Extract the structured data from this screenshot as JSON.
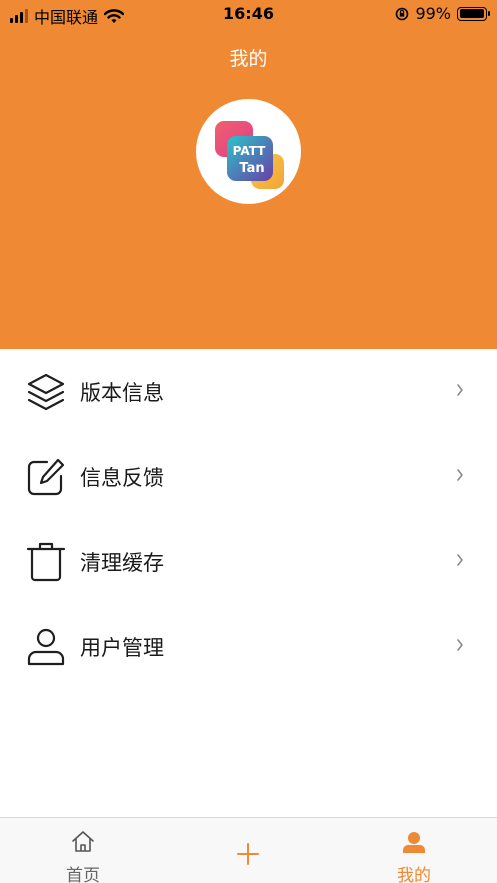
{
  "status_bar": {
    "carrier": "中国联通",
    "time": "16:46",
    "battery": "99%",
    "battery_level": 0.99
  },
  "header": {
    "title": "我的",
    "background": "#EF8933"
  },
  "avatar": {
    "icon": "patt-tan-logo",
    "line1": "PATT",
    "line2": "Tan"
  },
  "menu": {
    "items": [
      {
        "icon": "layers-icon",
        "label": "版本信息"
      },
      {
        "icon": "edit-icon",
        "label": "信息反馈"
      },
      {
        "icon": "trash-icon",
        "label": "清理缓存"
      },
      {
        "icon": "user-icon",
        "label": "用户管理"
      }
    ]
  },
  "tabbar": {
    "accent": "#EF8933",
    "tabs": [
      {
        "icon": "home-icon",
        "label": "首页",
        "active": false
      },
      {
        "icon": "plus-icon",
        "label": "",
        "active": false
      },
      {
        "icon": "user-icon",
        "label": "我的",
        "active": true
      }
    ]
  }
}
